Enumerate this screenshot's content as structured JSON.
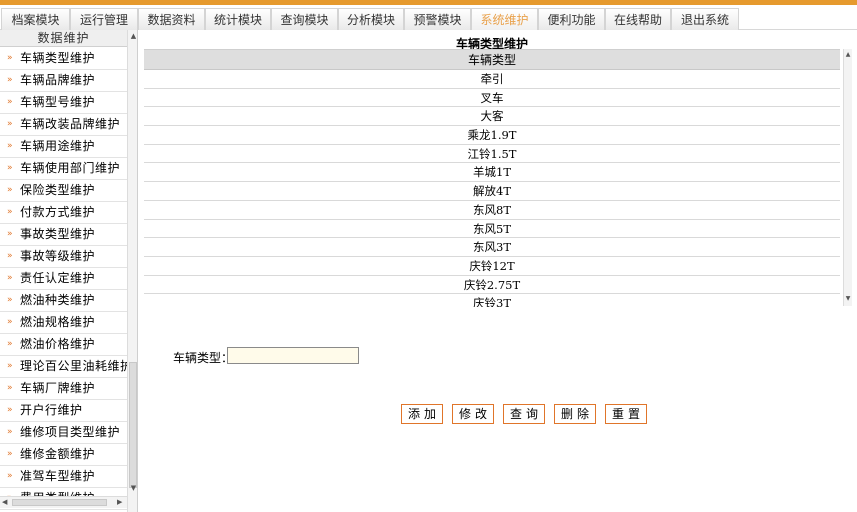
{
  "nav": {
    "tabs": [
      {
        "label": "档案模块"
      },
      {
        "label": "运行管理"
      },
      {
        "label": "数据资料"
      },
      {
        "label": "统计模块"
      },
      {
        "label": "查询模块"
      },
      {
        "label": "分析模块"
      },
      {
        "label": "预警模块"
      },
      {
        "label": "系统维护",
        "active": true
      },
      {
        "label": "便利功能"
      },
      {
        "label": "在线帮助"
      },
      {
        "label": "退出系统"
      }
    ]
  },
  "sidebar": {
    "header": "数据维护",
    "items": [
      {
        "label": "车辆类型维护"
      },
      {
        "label": "车辆品牌维护"
      },
      {
        "label": "车辆型号维护"
      },
      {
        "label": "车辆改装品牌维护"
      },
      {
        "label": "车辆用途维护"
      },
      {
        "label": "车辆使用部门维护"
      },
      {
        "label": "保险类型维护"
      },
      {
        "label": "付款方式维护"
      },
      {
        "label": "事故类型维护"
      },
      {
        "label": "事故等级维护"
      },
      {
        "label": "责任认定维护"
      },
      {
        "label": "燃油种类维护"
      },
      {
        "label": "燃油规格维护"
      },
      {
        "label": "燃油价格维护"
      },
      {
        "label": "理论百公里油耗维护"
      },
      {
        "label": "车辆厂牌维护"
      },
      {
        "label": "开户行维护"
      },
      {
        "label": "维修项目类型维护"
      },
      {
        "label": "维修金额维护"
      },
      {
        "label": "准驾车型维护"
      },
      {
        "label": "费用类型维护"
      }
    ]
  },
  "main": {
    "title": "车辆类型维护",
    "grid": {
      "column_header": "车辆类型",
      "rows": [
        "牵引",
        "叉车",
        "大客",
        "乘龙1.9T",
        "江铃1.5T",
        "羊城1T",
        "解放4T",
        "东风8T",
        "东风5T",
        "东风3T",
        "庆铃12T",
        "庆铃2.75T",
        "庆铃3T"
      ]
    },
    "form": {
      "label": "车辆类型：",
      "value": ""
    },
    "buttons": {
      "add": "添加",
      "edit": "修改",
      "query": "查询",
      "delete": "删除",
      "reset": "重置"
    }
  },
  "colors": {
    "accent": "#e69a2e",
    "button_border": "#e0752a",
    "active_tab_text": "#e9a14b",
    "input_background": "#fffbea"
  }
}
